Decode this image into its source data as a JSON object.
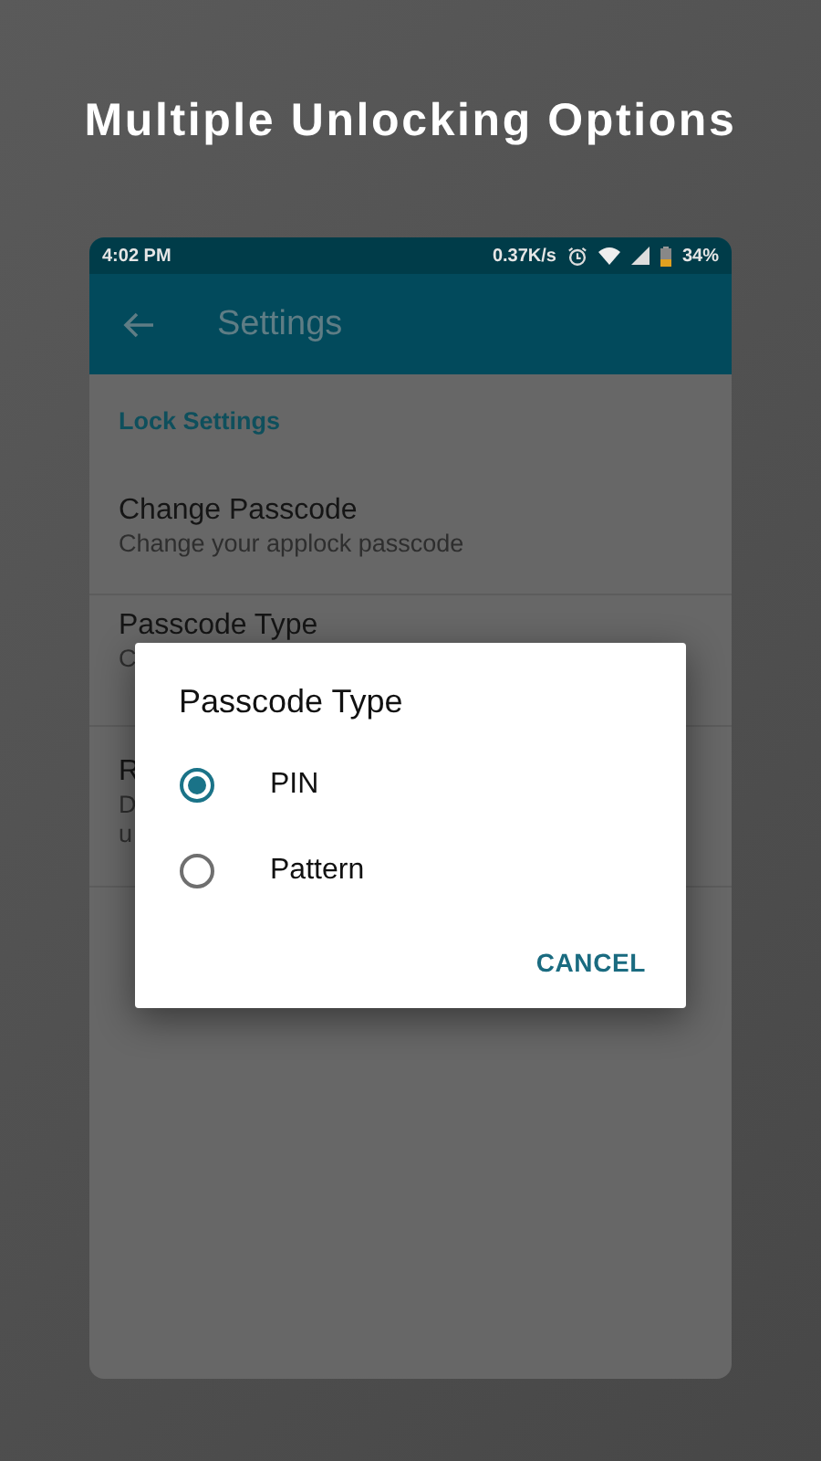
{
  "headline": "Multiple Unlocking Options",
  "status_bar": {
    "time": "4:02 PM",
    "speed": "0.37K/s",
    "battery": "34%"
  },
  "app_bar": {
    "title": "Settings"
  },
  "category": "Lock Settings",
  "preferences": [
    {
      "title": "Change Passcode",
      "summary": [
        "Change your applock passcode"
      ]
    },
    {
      "title": "Passcode Type",
      "summary": [
        "C"
      ]
    },
    {
      "title": "R",
      "summary": [
        "D",
        "u"
      ]
    }
  ],
  "dialog": {
    "title": "Passcode Type",
    "options": [
      {
        "label": "PIN",
        "selected": true
      },
      {
        "label": "Pattern",
        "selected": false
      }
    ],
    "buttons": [
      "CANCEL"
    ]
  }
}
